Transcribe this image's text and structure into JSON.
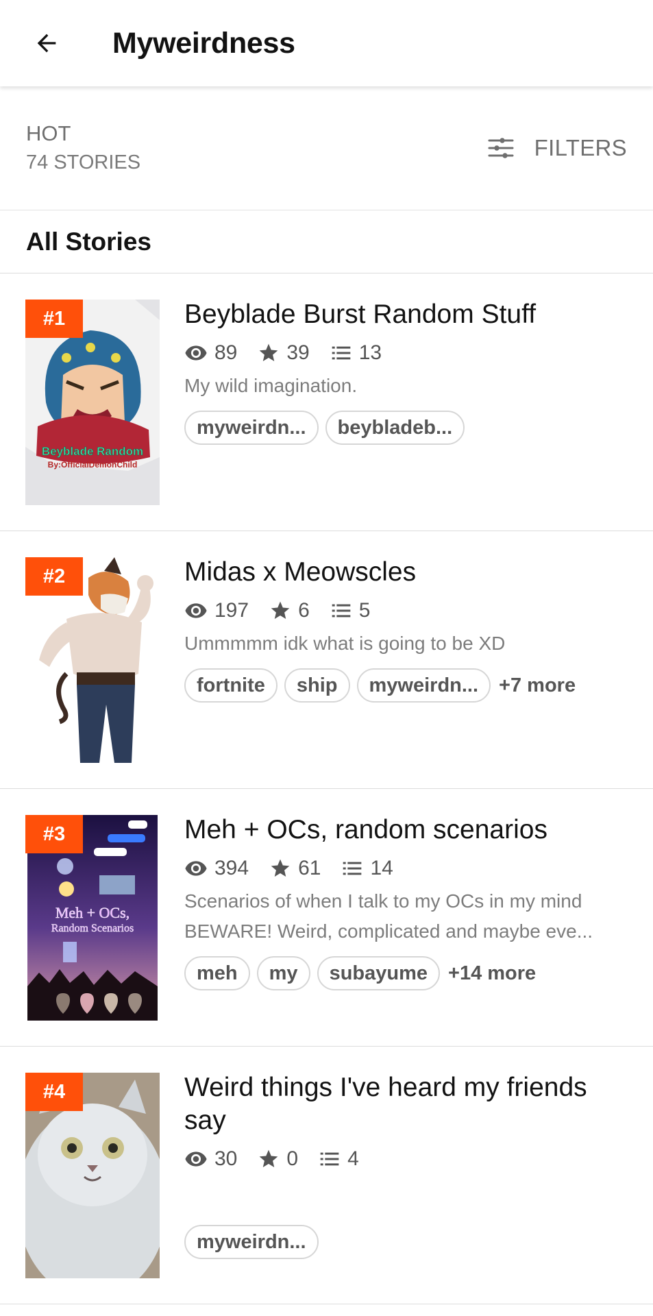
{
  "header": {
    "title": "Myweirdness"
  },
  "sort": {
    "label": "HOT",
    "count": "74 STORIES",
    "filters_label": "FILTERS"
  },
  "section": {
    "title": "All Stories"
  },
  "stories": [
    {
      "rank": "#1",
      "title": "Beyblade Burst Random Stuff",
      "reads": "89",
      "votes": "39",
      "parts": "13",
      "description": "My wild imagination.",
      "tags": [
        "myweirdn...",
        "beybladeb..."
      ],
      "more": "",
      "cover_text": [
        "Beyblade Random",
        "By:OfficialDemonChild"
      ]
    },
    {
      "rank": "#2",
      "title": "Midas x Meowscles",
      "reads": "197",
      "votes": "6",
      "parts": "5",
      "description": "Ummmmm idk what is going to be XD",
      "tags": [
        "fortnite",
        "ship",
        "myweirdn..."
      ],
      "more": "+7 more"
    },
    {
      "rank": "#3",
      "title": "Meh + OCs, random scenarios",
      "reads": "394",
      "votes": "61",
      "parts": "14",
      "description": "Scenarios of when I talk to my OCs in my mind BEWARE! Weird, complicated and maybe eve...",
      "tags": [
        "meh",
        "my",
        "subayume"
      ],
      "more": "+14 more",
      "cover_text": [
        "Meh + OCs,",
        "Random Scenarios"
      ]
    },
    {
      "rank": "#4",
      "title": "Weird things I've heard my friends say",
      "reads": "30",
      "votes": "0",
      "parts": "4",
      "description": "",
      "tags": [
        "myweirdn..."
      ],
      "more": ""
    }
  ],
  "colors": {
    "accent": "#ff500a",
    "text": "#121212",
    "muted": "#7c7c7c"
  },
  "icons": {
    "back": "arrow-left-icon",
    "filters": "sliders-icon",
    "reads": "eye-icon",
    "votes": "star-icon",
    "parts": "list-icon"
  }
}
